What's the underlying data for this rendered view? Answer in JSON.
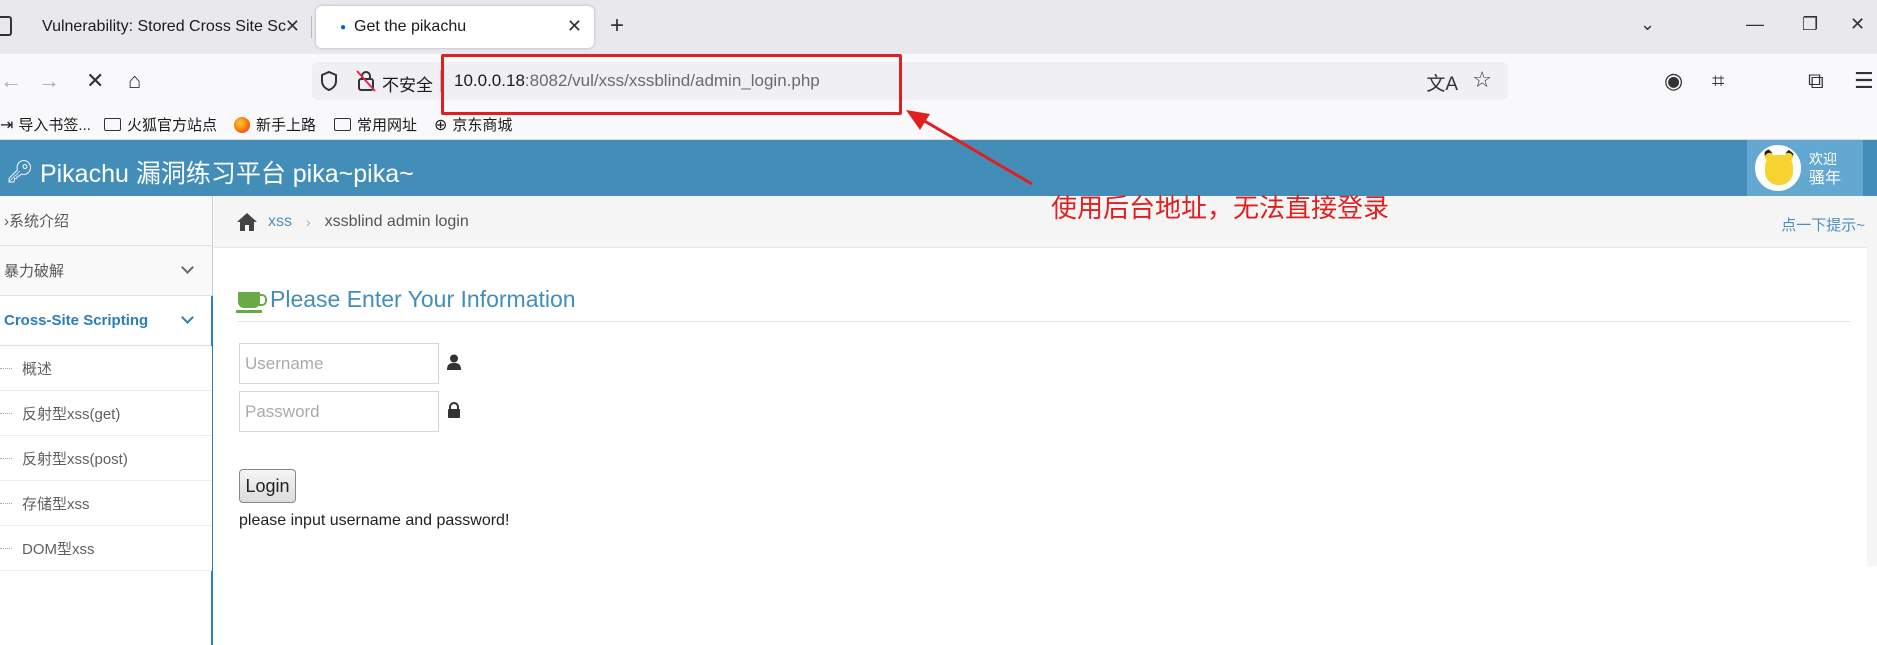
{
  "browser": {
    "tabs": [
      {
        "title": "Vulnerability: Stored Cross Site Sc",
        "active": false
      },
      {
        "title": "Get the pikachu",
        "active": true
      }
    ],
    "address": {
      "security_label": "不安全",
      "host": "10.0.0.18",
      "rest": ":8082/vul/xss/xssblind/admin_login.php"
    },
    "bookmarks": [
      "导入书签...",
      "火狐官方站点",
      "新手上路",
      "常用网址",
      "京东商城"
    ]
  },
  "header": {
    "brand": "Pikachu 漏洞练习平台 pika~pika~",
    "greeting": "欢迎",
    "user": "骚年"
  },
  "sidebar": {
    "items": [
      {
        "label": "系统介绍"
      },
      {
        "label": "暴力破解"
      },
      {
        "label": "Cross-Site Scripting"
      }
    ],
    "sub_items": [
      "概述",
      "反射型xss(get)",
      "反射型xss(post)",
      "存储型xss",
      "DOM型xss"
    ]
  },
  "breadcrumb": {
    "section": "xss",
    "current": "xssblind admin login",
    "hint": "点一下提示~"
  },
  "form": {
    "title": "Please Enter Your Information",
    "username_placeholder": "Username",
    "password_placeholder": "Password",
    "login_label": "Login",
    "message": "please input username and password!"
  },
  "annotation": {
    "text": "使用后台地址，无法直接登录",
    "color": "#e02020"
  },
  "colors": {
    "header": "#438eb9",
    "accent": "#4c8fbd"
  }
}
